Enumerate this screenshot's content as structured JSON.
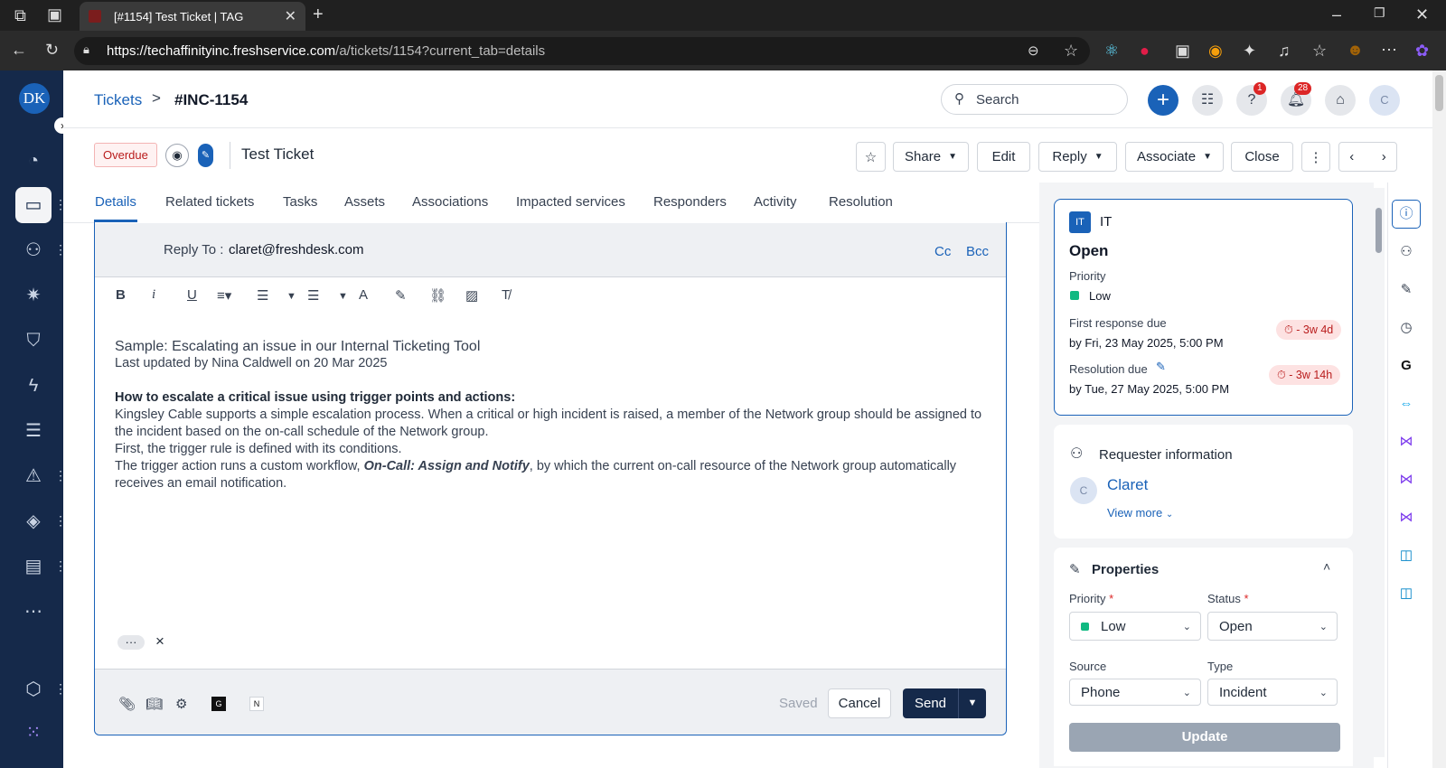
{
  "browser": {
    "tab_title": "[#1154] Test Ticket | TAG",
    "url_host": "https://techaffinityinc.freshservice.com",
    "url_path": "/a/tickets/1154?current_tab=details"
  },
  "nav": {
    "avatar_initials": "DK"
  },
  "header": {
    "breadcrumb_link": "Tickets",
    "breadcrumb_sep": ">",
    "ticket_id": "#INC-1154",
    "search_placeholder": "Search",
    "help_badge": "1",
    "notif_badge": "28",
    "user_avatar": "C"
  },
  "ticket": {
    "overdue_label": "Overdue",
    "title": "Test Ticket",
    "share_label": "Share",
    "edit_label": "Edit",
    "reply_label": "Reply",
    "associate_label": "Associate",
    "close_label": "Close"
  },
  "tabs": [
    "Details",
    "Related tickets",
    "Tasks",
    "Assets",
    "Associations",
    "Impacted services",
    "Responders",
    "Activity",
    "Resolution"
  ],
  "reply": {
    "reply_to_label": "Reply To :",
    "reply_to_value": "claret@freshdesk.com",
    "cc": "Cc",
    "bcc": "Bcc",
    "heading": "Sample: Escalating an issue in our Internal Ticketing Tool",
    "updated": "Last updated by Nina Caldwell on 20 Mar 2025",
    "subheading": "How to escalate a critical issue using trigger points and actions:",
    "para1": "Kingsley Cable supports a simple escalation process. When a critical or high incident is raised, a member of the Network group should be assigned to the incident based on the on-call schedule of the Network group.",
    "para2": "First, the trigger rule is defined with its conditions.",
    "para3_a": "The trigger action runs a custom workflow, ",
    "para3_b": "On-Call: Assign and Notify",
    "para3_c": ", by which the current on-call resource of the Network group automatically receives an email notification.",
    "more": "···",
    "close": "×",
    "saved": "Saved",
    "cancel": "Cancel",
    "send": "Send",
    "g_icon": "G",
    "n_icon": "N"
  },
  "status_card": {
    "group_badge": "IT",
    "group": "IT",
    "status": "Open",
    "priority_label": "Priority",
    "priority": "Low",
    "first_response_label": "First response due",
    "first_response": "by Fri, 23 May 2025, 5:00 PM",
    "first_response_sla": "- 3w 4d",
    "resolution_label": "Resolution due",
    "resolution": "by Tue, 27 May 2025, 5:00 PM",
    "resolution_sla": "- 3w 14h"
  },
  "requester": {
    "title": "Requester information",
    "avatar": "C",
    "name": "Claret",
    "view_more": "View more"
  },
  "properties": {
    "title": "Properties",
    "priority_label": "Priority",
    "priority_value": "Low",
    "status_label": "Status",
    "status_value": "Open",
    "source_label": "Source",
    "source_value": "Phone",
    "type_label": "Type",
    "type_value": "Incident",
    "required_mark": "*",
    "update": "Update"
  },
  "colors": {
    "accent": "#1a62b8",
    "nav_bg": "#15294a",
    "low_priority": "#10b981",
    "overdue": "#b91c1c"
  }
}
